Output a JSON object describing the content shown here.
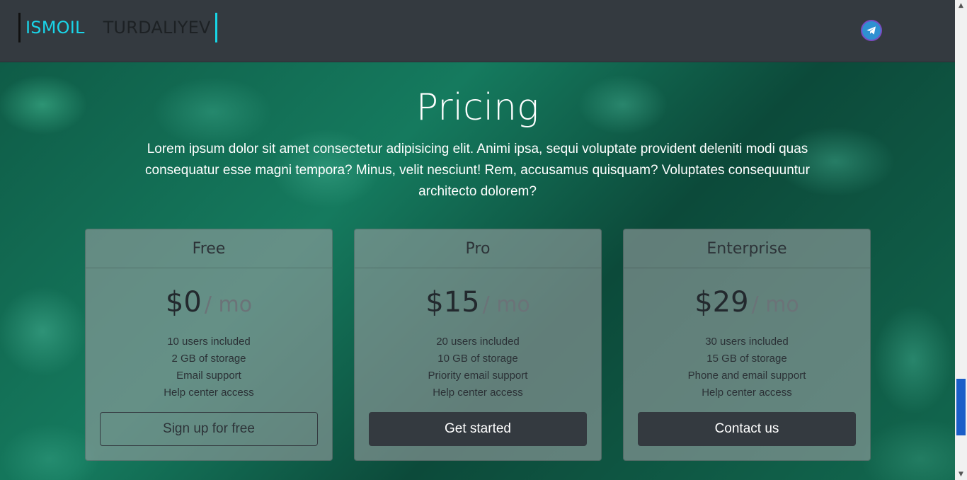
{
  "navbar": {
    "brand_first": "ISMOIL",
    "brand_last": "TURDALIYEV",
    "telegram_icon": "telegram-icon"
  },
  "hero": {
    "title": "Pricing",
    "lead": "Lorem ipsum dolor sit amet consectetur adipisicing elit. Animi ipsa, sequi voluptate provident deleniti modi quas consequatur esse magni tempora? Minus, velit nesciunt! Rem, accusamus quisquam? Voluptates consequuntur architecto dolorem?"
  },
  "plans": [
    {
      "name": "Free",
      "price": "$0",
      "period": "/ mo",
      "features": [
        "10 users included",
        "2 GB of storage",
        "Email support",
        "Help center access"
      ],
      "button": "Sign up for free"
    },
    {
      "name": "Pro",
      "price": "$15",
      "period": "/ mo",
      "features": [
        "20 users included",
        "10 GB of storage",
        "Priority email support",
        "Help center access"
      ],
      "button": "Get started"
    },
    {
      "name": "Enterprise",
      "price": "$29",
      "period": "/ mo",
      "features": [
        "30 users included",
        "15 GB of storage",
        "Phone and email support",
        "Help center access"
      ],
      "button": "Contact us"
    }
  ],
  "colors": {
    "accent": "#1ad4e8",
    "navbar_bg": "#343a40",
    "button_dark": "#343a40",
    "scroll_thumb": "#1a5ec8"
  }
}
